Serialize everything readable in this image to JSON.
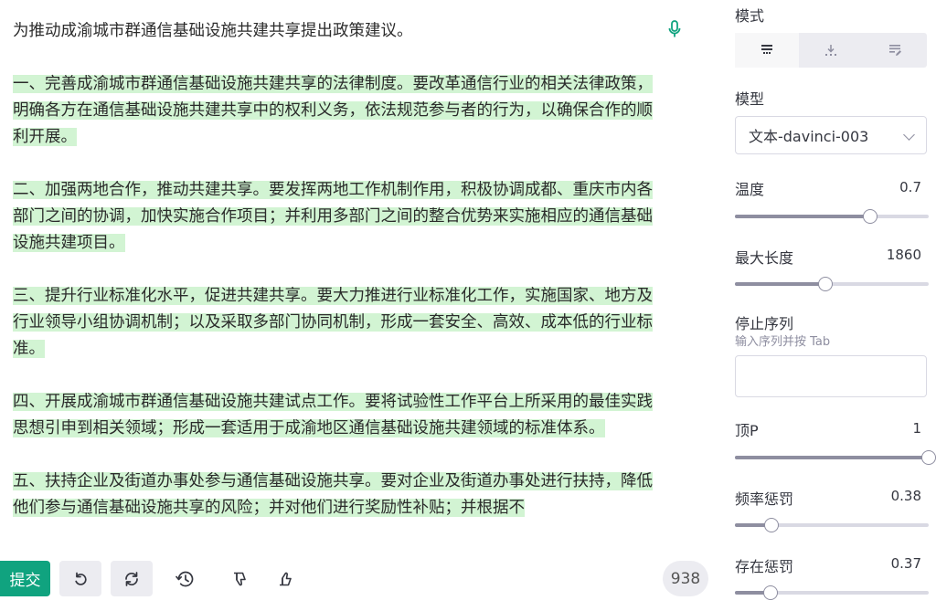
{
  "editor": {
    "prompt": "为推动成渝城市群通信基础设施共建共享提出政策建议。",
    "paragraphs": [
      "一、完善成渝城市群通信基础设施共建共享的法律制度。要改革通信行业的相关法律政策，明确各方在通信基础设施共建共享中的权利义务，依法规范参与者的行为，以确保合作的顺利开展。",
      "二、加强两地合作，推动共建共享。要发挥两地工作机制作用，积极协调成都、重庆市内各部门之间的协调，加快实施合作项目；并利用多部门之间的整合优势来实施相应的通信基础设施共建项目。",
      "三、提升行业标准化水平，促进共建共享。要大力推进行业标准化工作，实施国家、地方及行业领导小组协调机制；以及采取多部门协同机制，形成一套安全、高效、成本低的行业标准。",
      "四、开展成渝城市群通信基础设施共建试点工作。要将试验性工作平台上所采用的最佳实践思想引申到相关领域；形成一套适用于成渝地区通信基础设施共建领域的标准体系。",
      "五、扶持企业及街道办事处参与通信基础设施共享。要对企业及街道办事处进行扶持，降低他们参与通信基础设施共享的风险；并对他们进行奖励性补贴；并根据不"
    ]
  },
  "toolbar": {
    "submit_label": "提交",
    "token_count": "938"
  },
  "settings": {
    "mode_label": "模式",
    "model_label": "模型",
    "model_value": "文本-davinci-003",
    "temperature": {
      "label": "温度",
      "value": "0.7",
      "fraction": 0.7
    },
    "max_length": {
      "label": "最大长度",
      "value": "1860",
      "fraction": 0.465
    },
    "stop_sequence": {
      "label": "停止序列",
      "hint": "输入序列并按 Tab"
    },
    "top_p": {
      "label": "顶P",
      "value": "1",
      "fraction": 1.0
    },
    "frequency_penalty": {
      "label": "频率惩罚",
      "value": "0.38",
      "fraction": 0.19
    },
    "presence_penalty": {
      "label": "存在惩罚",
      "value": "0.37",
      "fraction": 0.185
    }
  },
  "colors": {
    "accent": "#10a37f",
    "highlight": "#d2f4d3"
  }
}
